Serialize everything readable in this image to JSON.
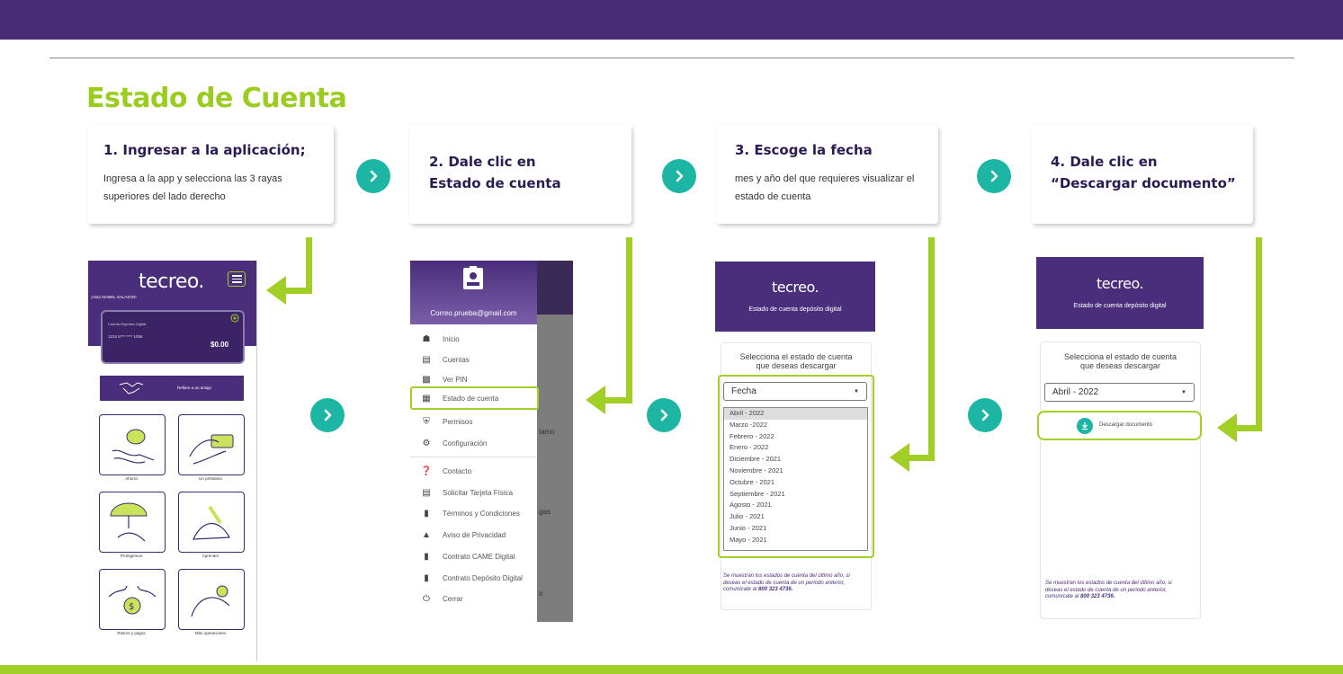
{
  "page": {
    "title": "Estado de Cuenta"
  },
  "steps": [
    {
      "title": "1. Ingresar a la aplicación;",
      "desc": "Ingresa a la app y selecciona las 3 rayas superiores del lado derecho"
    },
    {
      "title": "2. Dale clic en Estado de cuenta",
      "desc": ""
    },
    {
      "title": "3. Escoge  la fecha",
      "desc": "mes y año del que requieres visualizar el estado de cuenta"
    },
    {
      "title": "4. Dale clic en “Descargar documento”",
      "desc": ""
    }
  ],
  "colors": {
    "purple": "#482c73",
    "green": "#a2cf26",
    "teal": "#1db5a4",
    "title_green": "#9acd1f"
  },
  "app": {
    "logo": "tecreo.",
    "greeting": "¡Hola ISABEL SALAZAR!",
    "card_name": "Cuenta Depósito Digital",
    "card_number": "1234 5*** **** 1058",
    "balance": "$0.00",
    "referral": "Refiere a un amigo",
    "tiles": [
      "Ahorra",
      "Un préstamo",
      "Protegemos",
      "Aprender",
      "Retiros y pagos",
      "Más operaciones"
    ]
  },
  "menu": {
    "email": "Correo.prueba@gmail.com",
    "items": [
      {
        "label": "Inicio",
        "icon": "home-icon"
      },
      {
        "label": "Cuentas",
        "icon": "card-icon"
      },
      {
        "label": "Ver PIN",
        "icon": "pin-icon"
      },
      {
        "label": "Estado de cuenta",
        "icon": "statement-icon"
      },
      {
        "label": "Permisos",
        "icon": "shield-icon"
      },
      {
        "label": "Configuración",
        "icon": "settings-icon"
      },
      {
        "label": "Contacto",
        "icon": "help-icon"
      },
      {
        "label": "Solicitar Tarjeta Física",
        "icon": "card-icon"
      },
      {
        "label": "Términos y Condiciones",
        "icon": "clipboard-icon"
      },
      {
        "label": "Aviso de Privacidad",
        "icon": "warning-icon"
      },
      {
        "label": "Contrato CAME Digital",
        "icon": "clipboard-icon"
      },
      {
        "label": "Contrato Depósito Digital",
        "icon": "clipboard-icon"
      },
      {
        "label": "Cerrar",
        "icon": "power-icon"
      }
    ],
    "bg_text_1": "tamo",
    "bg_text_2": "gas",
    "bg_text_3": "o"
  },
  "statement": {
    "header_title": "Estado de cuenta depósito digital",
    "select_prompt_1": "Selecciona el estado de cuenta",
    "select_prompt_2": "que deseas descargar",
    "placeholder": "Fecha",
    "selected": "Abril - 2022",
    "months": [
      "Abril - 2022",
      "Marzo -2022",
      "Febrero - 2022",
      "Enero - 2022",
      "Diciembre - 2021",
      "Noviembre - 2021",
      "Octubre - 2021",
      "Septiembre - 2021",
      "Agosto - 2021",
      "Julio - 2021",
      "Junio - 2021",
      "Mayo - 2021"
    ],
    "note_1": "Se muestran los estados de cuenta del último año, si",
    "note_2": "deseas el estado de cuenta de un periodo anterior,",
    "note_3": "comunícate al",
    "phone": "800 323 4736.",
    "download": "Descargar documento"
  }
}
